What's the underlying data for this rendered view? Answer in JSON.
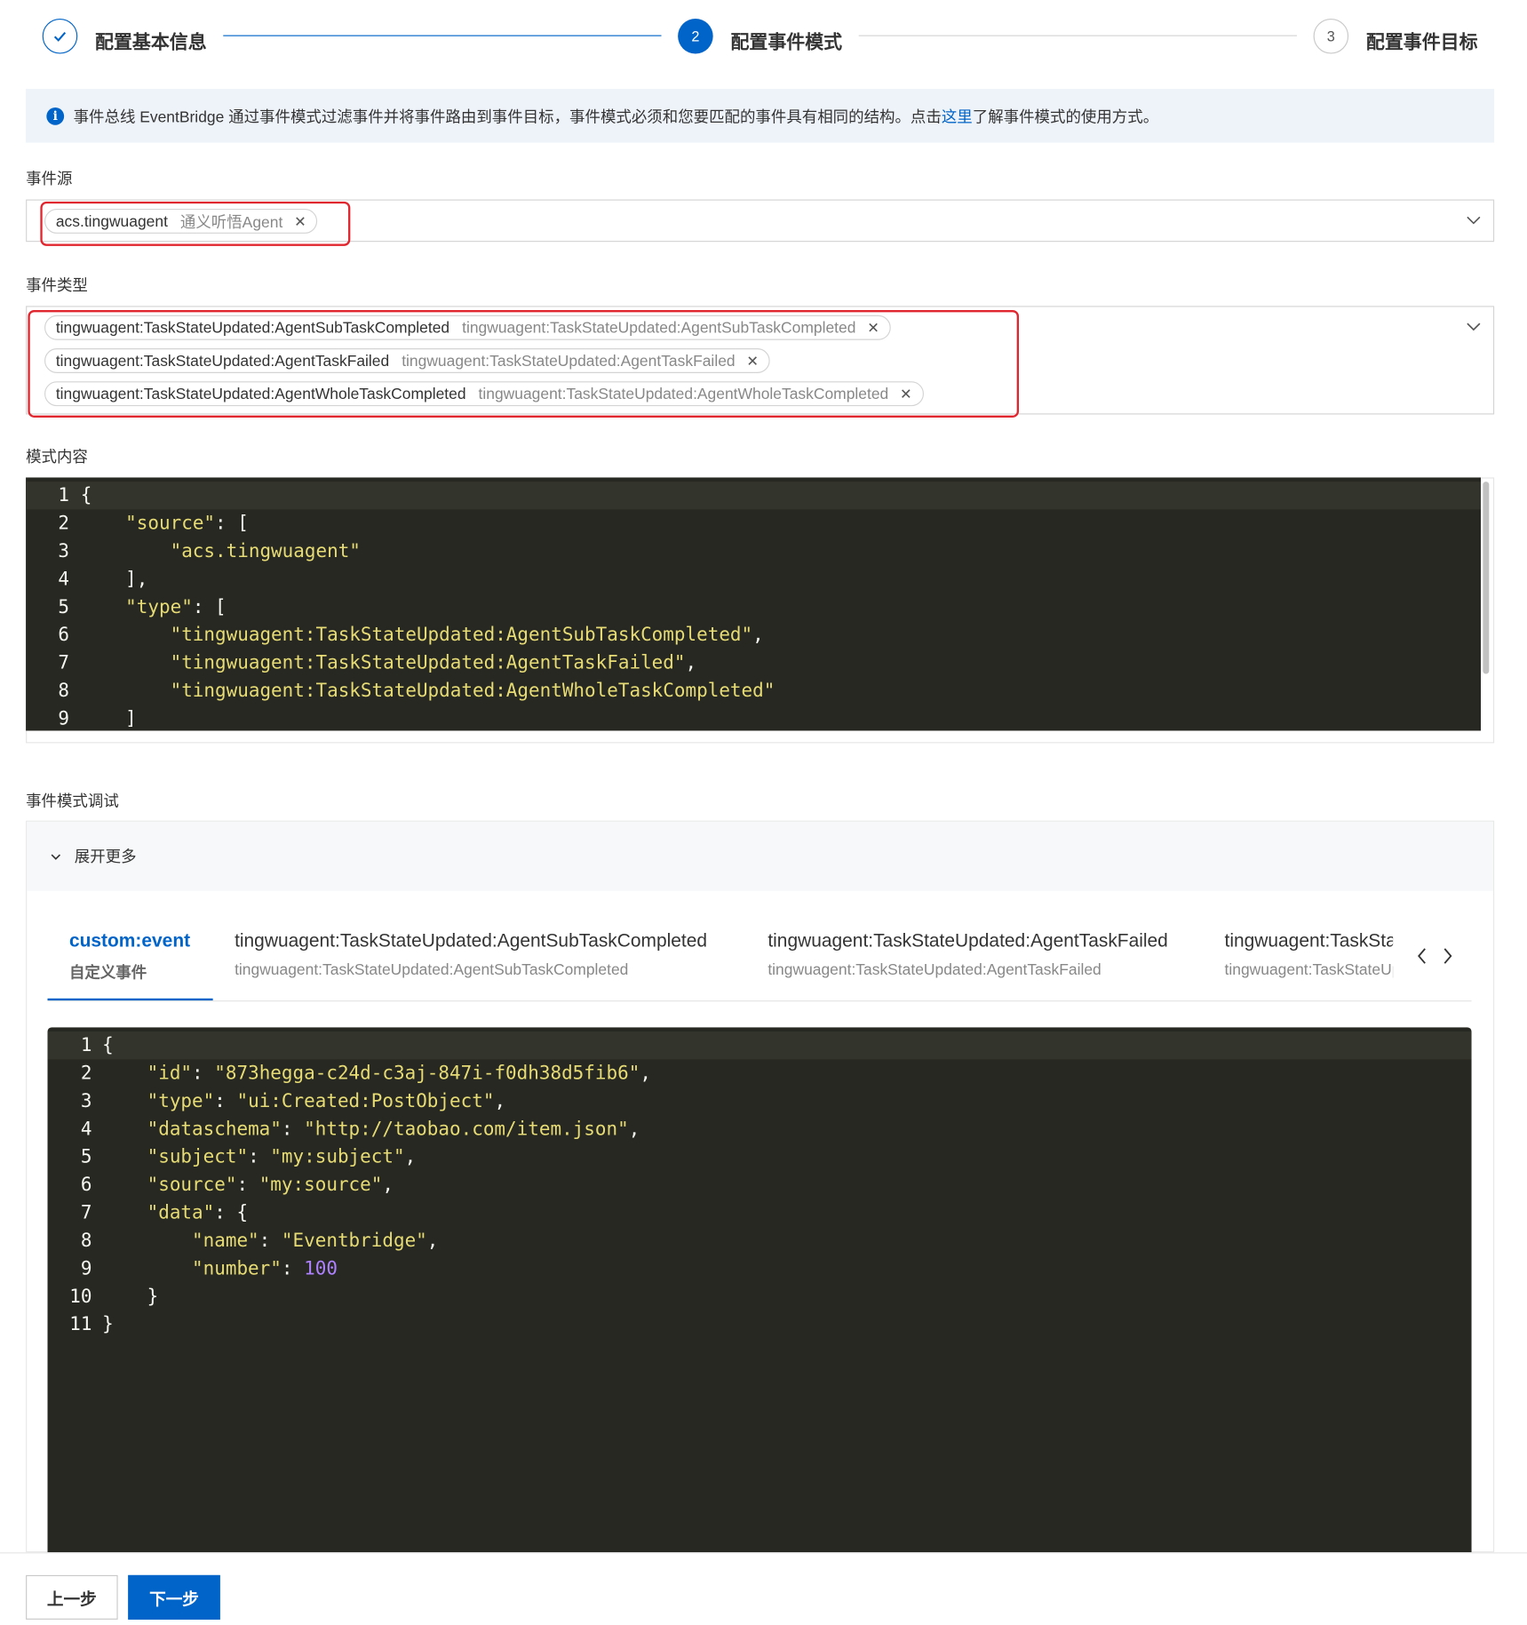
{
  "steps": [
    {
      "label": "配置基本信息",
      "status": "done"
    },
    {
      "label": "配置事件模式",
      "number": "2",
      "status": "current"
    },
    {
      "label": "配置事件目标",
      "number": "3",
      "status": "pending"
    }
  ],
  "info": {
    "text_before": "事件总线 EventBridge 通过事件模式过滤事件并将事件路由到事件目标，事件模式必须和您要匹配的事件具有相同的结构。点击",
    "link": "这里",
    "text_after": "了解事件模式的使用方式。"
  },
  "event_source": {
    "label": "事件源",
    "tag": {
      "value": "acs.tingwuagent",
      "desc": "通义听悟Agent"
    }
  },
  "event_type": {
    "label": "事件类型",
    "tags": [
      {
        "value": "tingwuagent:TaskStateUpdated:AgentSubTaskCompleted",
        "desc": "tingwuagent:TaskStateUpdated:AgentSubTaskCompleted"
      },
      {
        "value": "tingwuagent:TaskStateUpdated:AgentTaskFailed",
        "desc": "tingwuagent:TaskStateUpdated:AgentTaskFailed"
      },
      {
        "value": "tingwuagent:TaskStateUpdated:AgentWholeTaskCompleted",
        "desc": "tingwuagent:TaskStateUpdated:AgentWholeTaskCompleted"
      }
    ]
  },
  "pattern": {
    "label": "模式内容",
    "lines": [
      "{",
      "    \"source\": [",
      "        \"acs.tingwuagent\"",
      "    ],",
      "    \"type\": [",
      "        \"tingwuagent:TaskStateUpdated:AgentSubTaskCompleted\",",
      "        \"tingwuagent:TaskStateUpdated:AgentTaskFailed\",",
      "        \"tingwuagent:TaskStateUpdated:AgentWholeTaskCompleted\"",
      "    ]"
    ]
  },
  "debug": {
    "label": "事件模式调试",
    "expand_label": "展开更多",
    "tabs": [
      {
        "title": "custom:event",
        "subtitle": "自定义事件",
        "selected": true
      },
      {
        "title": "tingwuagent:TaskStateUpdated:AgentSubTaskCompleted",
        "subtitle": "tingwuagent:TaskStateUpdated:AgentSubTaskCompleted"
      },
      {
        "title": "tingwuagent:TaskStateUpdated:AgentTaskFailed",
        "subtitle": "tingwuagent:TaskStateUpdated:AgentTaskFailed"
      },
      {
        "title": "tingwuagent:TaskStateUpdated:AgentWholeTaskCompleted",
        "subtitle": "tingwuagent:TaskStateUpdated:AgentWholeTaskCompleted"
      }
    ],
    "sample_lines": [
      "{",
      "    \"id\": \"873hegga-c24d-c3aj-847i-f0dh38d5fib6\",",
      "    \"type\": \"ui:Created:PostObject\",",
      "    \"dataschema\": \"http://taobao.com/item.json\",",
      "    \"subject\": \"my:subject\",",
      "    \"source\": \"my:source\",",
      "    \"data\": {",
      "        \"name\": \"Eventbridge\",",
      "        \"number\": 100",
      "    }",
      "}"
    ]
  },
  "footer": {
    "prev_label": "上一步",
    "next_label": "下一步"
  },
  "colors": {
    "primary": "#0064c8",
    "highlight": "#e0262f",
    "editor_bg": "#272822",
    "string": "#e6db74",
    "number": "#ae81ff"
  }
}
